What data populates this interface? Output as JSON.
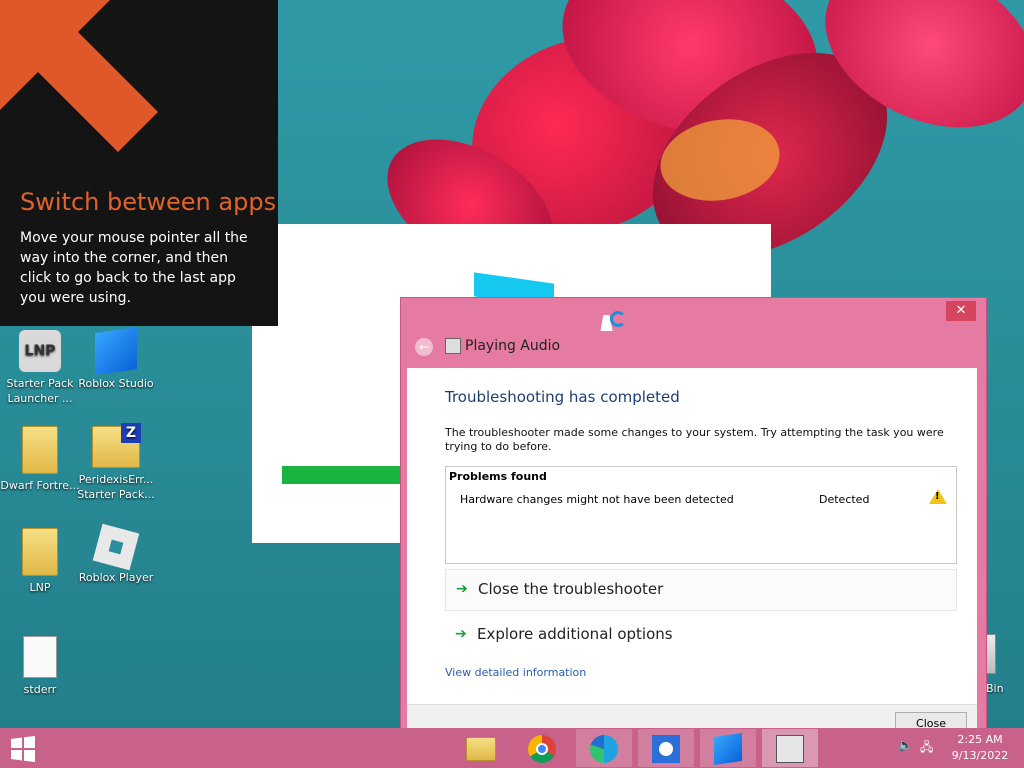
{
  "tip": {
    "title": "Switch between apps",
    "body": "Move your mouse pointer all the way into the corner, and then click to go back to the last app you were using."
  },
  "desktop_icons": [
    {
      "label": "Starter Pack Launcher ...",
      "icon": "lnp-launcher-icon"
    },
    {
      "label": "Roblox Studio",
      "icon": "roblox-studio-icon"
    },
    {
      "label": "Dwarf Fortre...",
      "icon": "folder-icon"
    },
    {
      "label": "PeridexisErr... Starter Pack...",
      "icon": "zip-folder-icon"
    },
    {
      "label": "LNP",
      "icon": "folder-icon"
    },
    {
      "label": "Roblox Player",
      "icon": "roblox-player-icon"
    },
    {
      "label": "stderr",
      "icon": "text-file-icon"
    },
    {
      "label": "Bin",
      "icon": "recycle-bin-icon"
    }
  ],
  "dialog": {
    "close_glyph": "✕",
    "title": "Playing Audio",
    "heading": "Troubleshooting has completed",
    "description": "The troubleshooter made some changes to your system. Try attempting the task you were trying to do before.",
    "problems_header": "Problems found",
    "problems": [
      {
        "text": "Hardware changes might not have been detected",
        "status": "Detected",
        "icon": "warning-icon"
      }
    ],
    "options": [
      "Close the troubleshooter",
      "Explore additional options"
    ],
    "detail_link": "View detailed information",
    "close_button": "Close"
  },
  "taskbar": {
    "items": [
      "file-explorer-icon",
      "chrome-icon",
      "edge-icon",
      "brightness-icon",
      "roblox-studio-icon",
      "audio-troubleshooter-icon"
    ],
    "time": "2:25 AM",
    "date": "9/13/2022"
  },
  "colors": {
    "accent": "#c8628a",
    "dialog_frame": "#e57ba2",
    "tip_title": "#e2622b",
    "heading": "#1e3e73",
    "link": "#2a5caa"
  }
}
